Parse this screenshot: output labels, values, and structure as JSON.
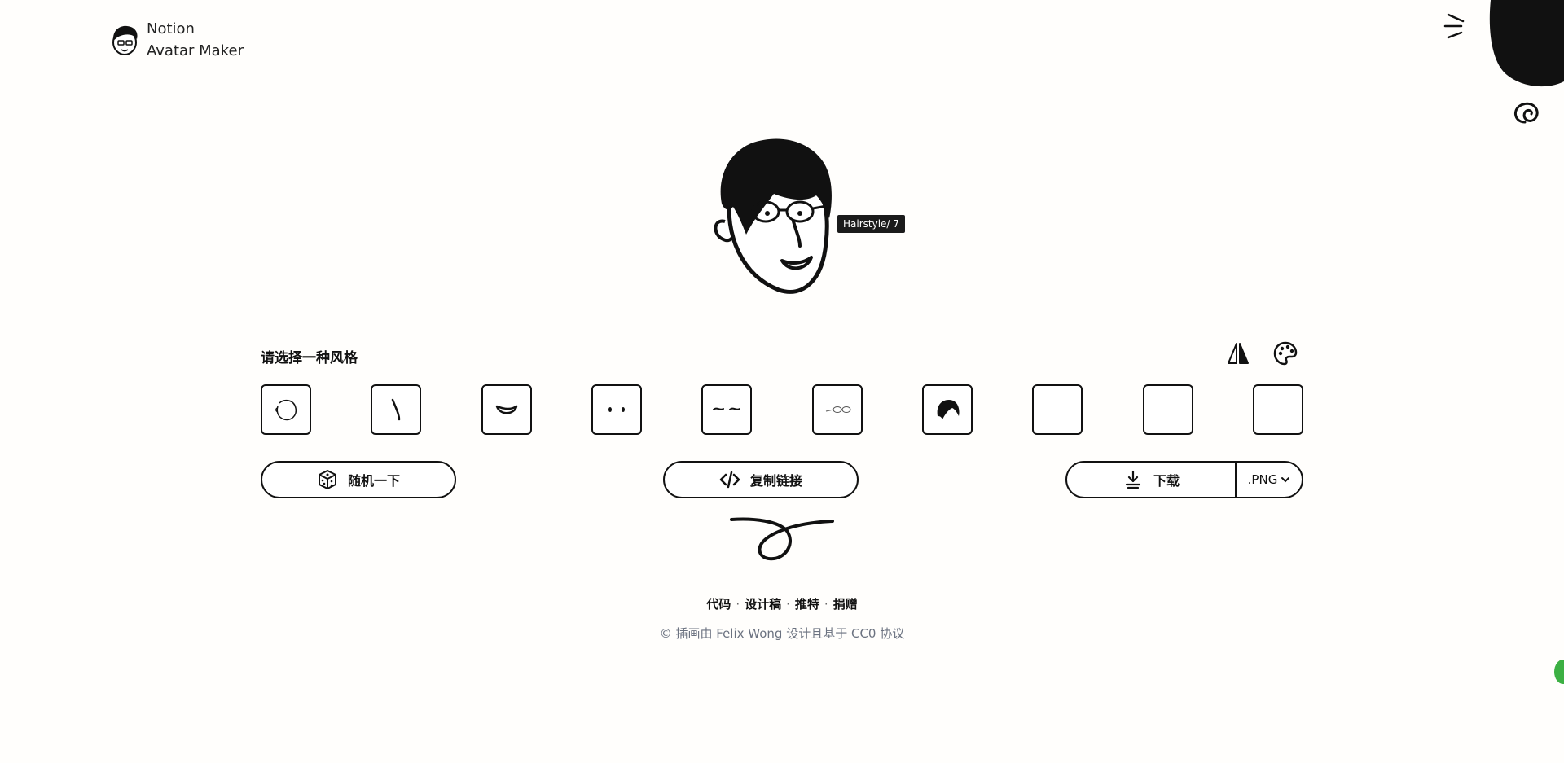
{
  "header": {
    "app_name_line1": "Notion",
    "app_name_line2": "Avatar Maker"
  },
  "preview": {
    "tooltip": "Hairstyle/ 7"
  },
  "section": {
    "title": "请选择一种风格"
  },
  "tools": {
    "flip_icon": "flip-icon",
    "palette_icon": "palette-icon"
  },
  "tiles": [
    {
      "name": "face",
      "icon": "face-shape-icon"
    },
    {
      "name": "nose",
      "icon": "nose-icon"
    },
    {
      "name": "mouth",
      "icon": "mouth-icon"
    },
    {
      "name": "eyes",
      "icon": "eyes-icon"
    },
    {
      "name": "eyebrows",
      "icon": "eyebrows-icon"
    },
    {
      "name": "glasses",
      "icon": "glasses-icon"
    },
    {
      "name": "hairstyle",
      "icon": "hair-icon"
    },
    {
      "name": "accessories",
      "icon": "empty"
    },
    {
      "name": "details",
      "icon": "empty"
    },
    {
      "name": "beard",
      "icon": "empty"
    }
  ],
  "actions": {
    "random_label": "随机一下",
    "copy_label": "复制链接",
    "download_label": "下载",
    "format_value": ".PNG"
  },
  "footer": {
    "links": [
      "代码",
      "设计稿",
      "推特",
      "捐赠"
    ],
    "credit": "© 插画由 Felix Wong 设计且基于 CC0 协议"
  }
}
